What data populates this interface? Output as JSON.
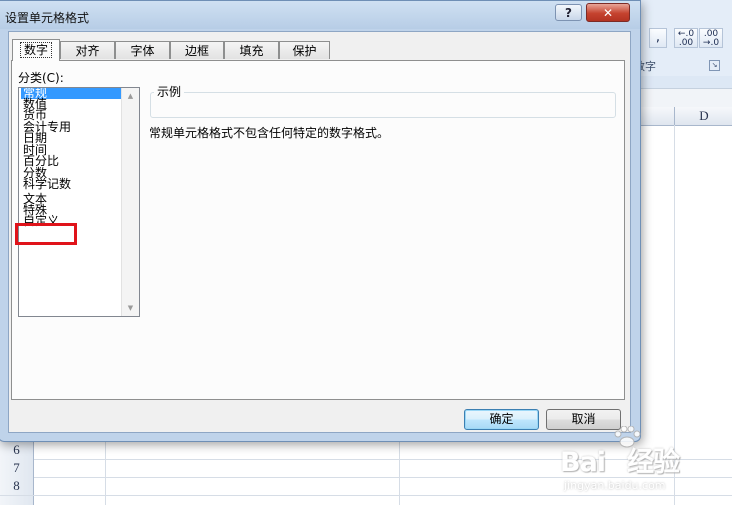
{
  "ribbon": {
    "comma_label": ",",
    "increase_decimal": ".0\n.00",
    "decrease_decimal": ".00\n.0",
    "group_label": "数字",
    "launcher_icon": "dialog-launcher-icon"
  },
  "sheet": {
    "column_d": "D",
    "rows": [
      "6",
      "7",
      "8"
    ]
  },
  "dialog": {
    "title": "设置单元格格式",
    "help_label": "?",
    "close_label": "✕",
    "tabs": [
      "数字",
      "对齐",
      "字体",
      "边框",
      "填充",
      "保护"
    ],
    "active_tab": "数字",
    "category_label": "分类(C):",
    "categories": [
      "常规",
      "数值",
      "货币",
      "会计专用",
      "日期",
      "时间",
      "百分比",
      "分数",
      "科学记数",
      "文本",
      "特殊",
      "自定义"
    ],
    "selected_category": "常规",
    "highlighted_category": "文本",
    "sample_label": "示例",
    "description": "常规单元格格式不包含任何特定的数字格式。",
    "ok_label": "确定",
    "cancel_label": "取消"
  },
  "watermark": {
    "brand": "Bai",
    "suffix": "经验",
    "url": "jingyan.baidu.com"
  },
  "colors": {
    "highlight_box": "#e0131a",
    "selection": "#3399ff",
    "title_bar": "#c4d6ed"
  }
}
